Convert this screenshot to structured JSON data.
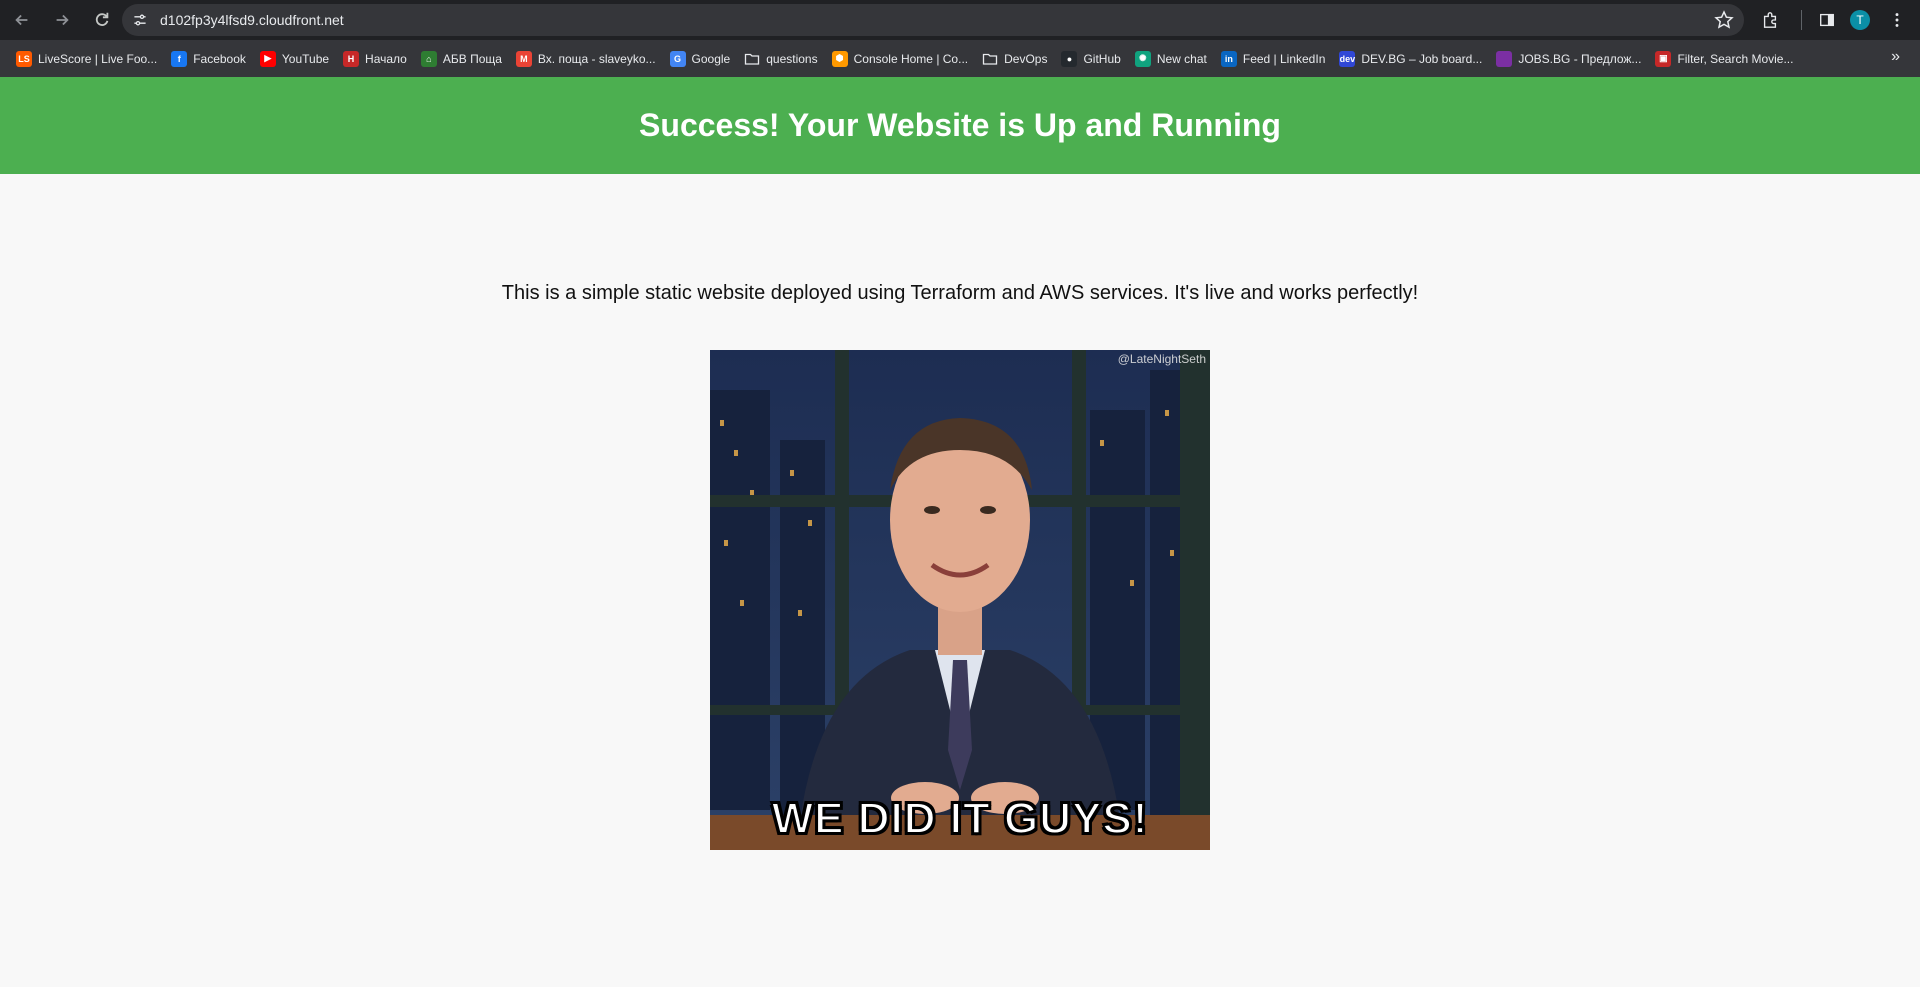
{
  "browser": {
    "url": "d102fp3y4lfsd9.cloudfront.net",
    "avatar_initial": "T",
    "bookmarks": [
      {
        "label": "LiveScore | Live Foo...",
        "icon": "livescore-icon",
        "color": "#ff5a00",
        "glyph": "LS"
      },
      {
        "label": "Facebook",
        "icon": "facebook-icon",
        "color": "#1877f2",
        "glyph": "f"
      },
      {
        "label": "YouTube",
        "icon": "youtube-icon",
        "color": "#ff0000",
        "glyph": "▶"
      },
      {
        "label": "Начало",
        "icon": "nachalo-icon",
        "color": "#c62828",
        "glyph": "Н"
      },
      {
        "label": "АБВ Поща",
        "icon": "abv-icon",
        "color": "#2e7d32",
        "glyph": "⌂"
      },
      {
        "label": "Вх. поща - slaveyko...",
        "icon": "gmail-icon",
        "color": "#ea4335",
        "glyph": "M"
      },
      {
        "label": "Google",
        "icon": "google-icon",
        "color": "#4285f4",
        "glyph": "G"
      },
      {
        "label": "questions",
        "icon": "folder-icon",
        "color": "",
        "glyph": ""
      },
      {
        "label": "Console Home | Co...",
        "icon": "aws-icon",
        "color": "#ff9900",
        "glyph": "⬢"
      },
      {
        "label": "DevOps",
        "icon": "folder-icon",
        "color": "",
        "glyph": ""
      },
      {
        "label": "GitHub",
        "icon": "github-icon",
        "color": "#24292e",
        "glyph": "●"
      },
      {
        "label": "New chat",
        "icon": "chatgpt-icon",
        "color": "#10a37f",
        "glyph": "✺"
      },
      {
        "label": "Feed | LinkedIn",
        "icon": "linkedin-icon",
        "color": "#0a66c2",
        "glyph": "in"
      },
      {
        "label": "DEV.BG – Job board...",
        "icon": "devbg-icon",
        "color": "#3047d6",
        "glyph": "dev"
      },
      {
        "label": "JOBS.BG - Предлож...",
        "icon": "jobsbg-icon",
        "color": "#7b2fa3",
        "glyph": ""
      },
      {
        "label": "Filter, Search Movie...",
        "icon": "movie-icon",
        "color": "#c62828",
        "glyph": "▣"
      }
    ]
  },
  "page": {
    "heading": "Success! Your Website is Up and Running",
    "intro": "This is a simple static website deployed using Terraform and AWS services. It's live and works perfectly!",
    "gif": {
      "watermark": "@LateNightSeth",
      "caption": "WE DID IT GUYS!"
    }
  }
}
